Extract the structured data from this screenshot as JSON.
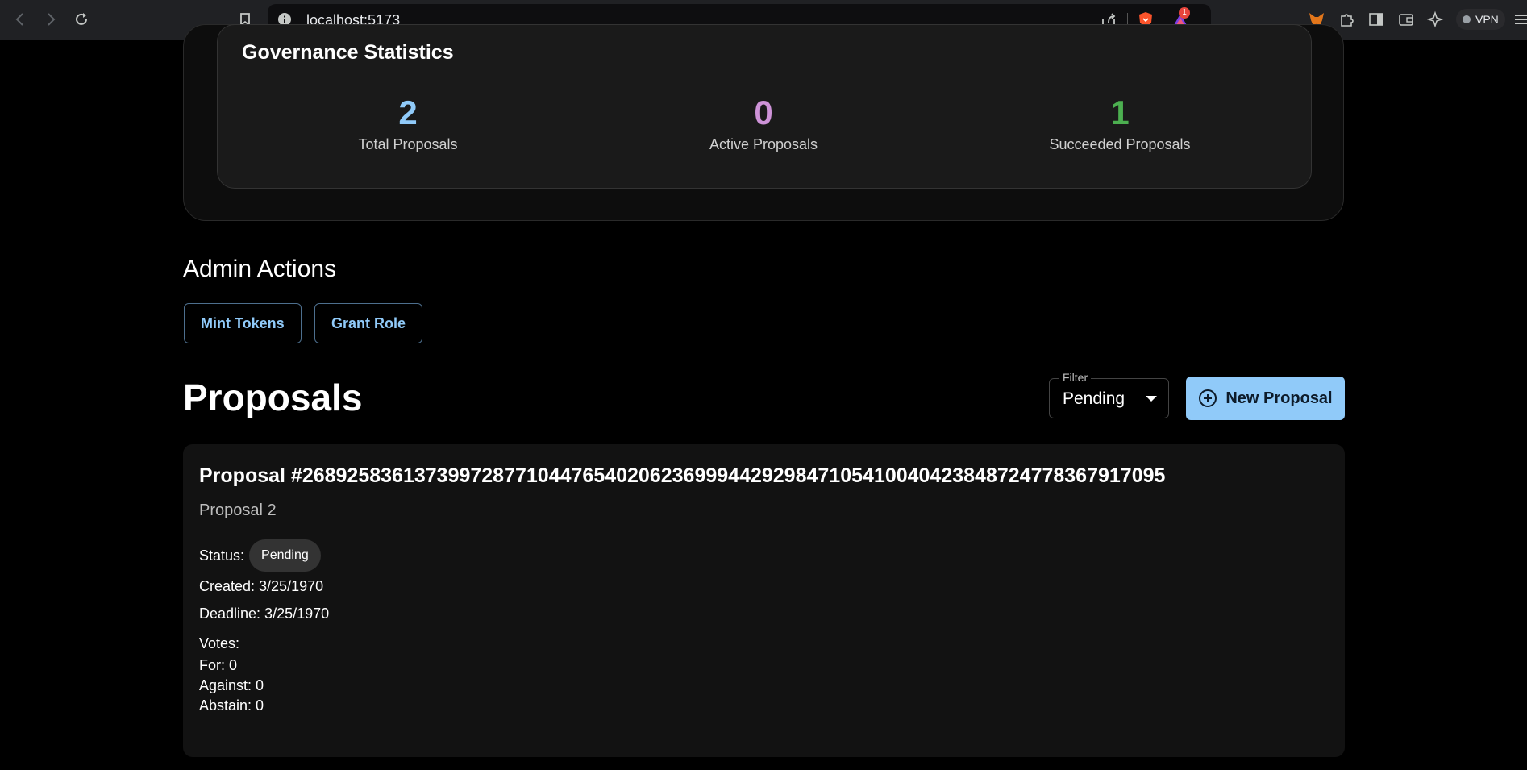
{
  "browser": {
    "url": "localhost:5173",
    "notification_count": "1",
    "vpn_label": "VPN"
  },
  "stats": {
    "title": "Governance Statistics",
    "items": [
      {
        "value": "2",
        "label": "Total Proposals",
        "color": "#90caf9"
      },
      {
        "value": "0",
        "label": "Active Proposals",
        "color": "#ce93d8"
      },
      {
        "value": "1",
        "label": "Succeeded Proposals",
        "color": "#4caf50"
      }
    ]
  },
  "admin": {
    "title": "Admin Actions",
    "mint_label": "Mint Tokens",
    "grant_label": "Grant Role"
  },
  "proposals": {
    "title": "Proposals",
    "filter_label": "Filter",
    "filter_value": "Pending",
    "new_label": "New Proposal",
    "card": {
      "title": "Proposal #26892583613739972877104476540206236999442929847105410040423848724778367917095",
      "description": "Proposal 2",
      "status_label": "Status:",
      "status_value": "Pending",
      "created": "Created: 3/25/1970",
      "deadline": "Deadline: 3/25/1970",
      "votes_label": "Votes:",
      "votes_for": "For: 0",
      "votes_against": "Against: 0",
      "votes_abstain": "Abstain: 0"
    }
  },
  "colors": {
    "accent": "#90caf9",
    "background": "#000000"
  }
}
